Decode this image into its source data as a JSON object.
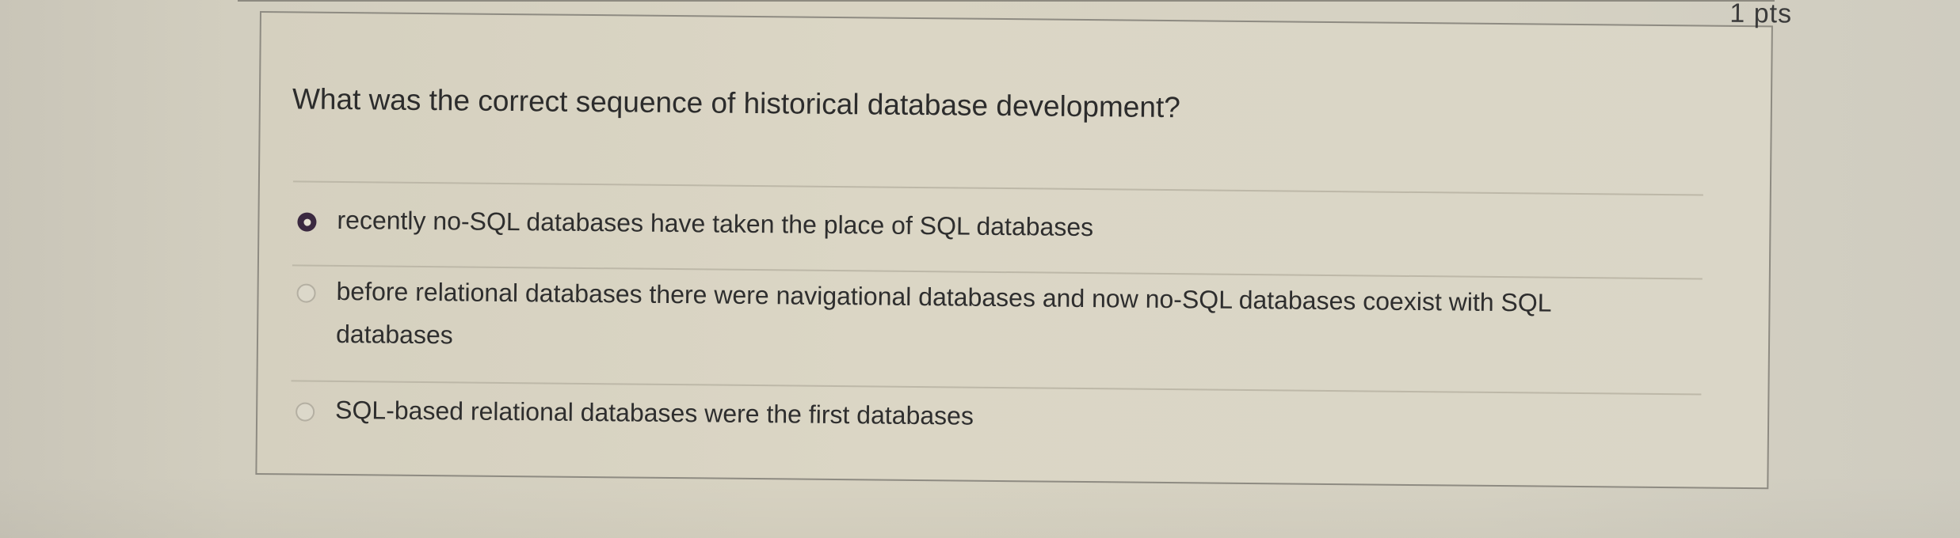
{
  "question": {
    "text": "What was the correct sequence of historical database development?",
    "points": "1 pts"
  },
  "answers": [
    {
      "label": "recently no-SQL databases have taken the place of SQL databases",
      "selected": true
    },
    {
      "label": "before relational databases there were navigational databases and now no-SQL databases coexist with SQL databases",
      "selected": false
    },
    {
      "label": "SQL-based relational databases were the first databases",
      "selected": false
    }
  ]
}
